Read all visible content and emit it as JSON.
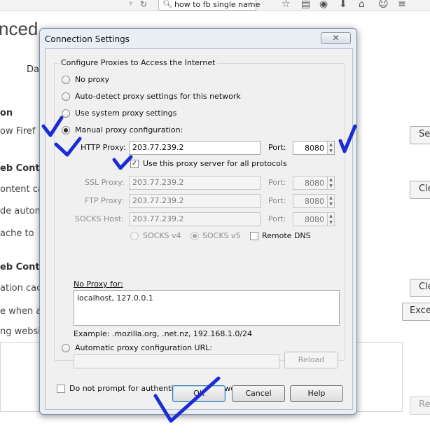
{
  "browser": {
    "search_query": "how to fb single name",
    "search_go_glyph": "→"
  },
  "background_page": {
    "title_fragment": "nced",
    "tab_fragment": "Da",
    "texts": [
      {
        "text": "on",
        "bold": true
      },
      {
        "text": "ow Firef",
        "bold": false
      },
      {
        "text": "eb Cont",
        "bold": true
      },
      {
        "text": "ontent ca",
        "bold": false
      },
      {
        "text": "de autom",
        "bold": false
      },
      {
        "text": "ache to",
        "bold": false
      },
      {
        "text": "eb Cont",
        "bold": true
      },
      {
        "text": "ation cac",
        "bold": false
      },
      {
        "text": "e when a",
        "bold": false
      },
      {
        "text": "ng websi",
        "bold": false
      }
    ],
    "buttons": [
      "Se",
      "Cle",
      "Cle",
      "Exce",
      "Re"
    ]
  },
  "dialog": {
    "title": "Connection Settings",
    "group_label": "Configure Proxies to Access the Internet",
    "options": {
      "no_proxy": "No proxy",
      "auto_detect": "Auto-detect proxy settings for this network",
      "system": "Use system proxy settings",
      "manual": "Manual proxy configuration:",
      "selected": "manual"
    },
    "http": {
      "label": "HTTP Proxy:",
      "host": "203.77.239.2",
      "port_label": "Port:",
      "port": "8080"
    },
    "use_for_all": {
      "label": "Use this proxy server for all protocols",
      "checked": true
    },
    "ssl": {
      "label": "SSL Proxy:",
      "host": "203.77.239.2",
      "port_label": "Port:",
      "port": "8080"
    },
    "ftp": {
      "label": "FTP Proxy:",
      "host": "203.77.239.2",
      "port_label": "Port:",
      "port": "8080"
    },
    "socks": {
      "label": "SOCKS Host:",
      "host": "203.77.239.2",
      "port_label": "Port:",
      "port": "8080"
    },
    "socks_v4": "SOCKS v4",
    "socks_v5": "SOCKS v5",
    "socks_selected": "v5",
    "remote_dns": {
      "label": "Remote DNS",
      "checked": false
    },
    "no_proxy_label": "No Proxy for:",
    "no_proxy_value": "localhost, 127.0.0.1",
    "example": "Example: .mozilla.org, .net.nz, 192.168.1.0/24",
    "auto_url": {
      "label": "Automatic proxy configuration URL:",
      "value": ""
    },
    "reload_button": "Reload",
    "auth": {
      "label": "Do not prompt for authentication if password is saved",
      "checked": false
    },
    "buttons": {
      "ok": "OK",
      "cancel": "Cancel",
      "help": "Help"
    }
  },
  "colors": {
    "annotation_ink": "#1b2bd6",
    "dialog_frame": "#e9eef5",
    "dialog_body": "#f0f0f0"
  }
}
